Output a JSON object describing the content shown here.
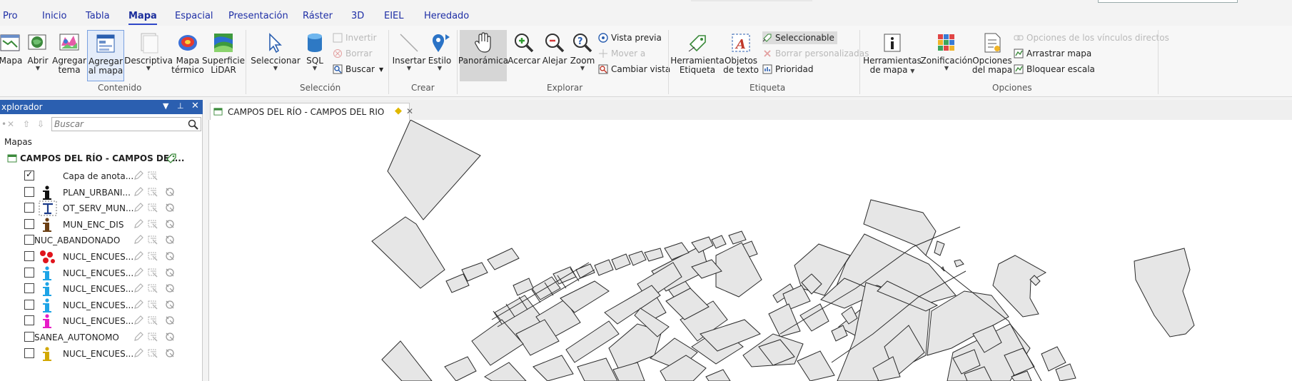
{
  "ribbon": {
    "tabs": [
      "Pro",
      "Inicio",
      "Tabla",
      "Mapa",
      "Espacial",
      "Presentación",
      "Ráster",
      "3D",
      "EIEL",
      "Heredado"
    ],
    "active_tab": "Mapa",
    "groups": {
      "contenido": {
        "label": "Contenido",
        "mapa": "Mapa",
        "abrir": "Abrir",
        "agregar_tema_1": "Agregar",
        "agregar_tema_2": "tema",
        "agregar_mapa_1": "Agregar",
        "agregar_mapa_2": "al mapa",
        "descriptiva": "Descriptiva",
        "termico_1": "Mapa",
        "termico_2": "térmico",
        "lidar_1": "Superficie",
        "lidar_2": "LiDAR"
      },
      "seleccion": {
        "label": "Selección",
        "seleccionar": "Seleccionar",
        "sql": "SQL",
        "invertir": "Invertir",
        "borrar": "Borrar",
        "buscar": "Buscar"
      },
      "crear": {
        "label": "Crear",
        "insertar": "Insertar",
        "estilo": "Estilo"
      },
      "explorar": {
        "label": "Explorar",
        "panoramica": "Panorámica",
        "acercar": "Acercar",
        "alejar": "Alejar",
        "zoom": "Zoom",
        "vista_previa": "Vista previa",
        "mover_a": "Mover a",
        "cambiar_vista": "Cambiar vista"
      },
      "etiqueta": {
        "label": "Etiqueta",
        "herramienta_1": "Herramienta",
        "herramienta_2": "Etiqueta",
        "objetos_1": "Objetos",
        "objetos_2": "de texto",
        "seleccionable": "Seleccionable",
        "borrar_personalizadas": "Borrar personalizadas",
        "prioridad": "Prioridad"
      },
      "opciones": {
        "label": "Opciones",
        "herramientas_1": "Herramientas",
        "herramientas_2": "de mapa",
        "zonificacion": "Zonificación",
        "opciones_1": "Opciones",
        "opciones_2": "del mapa",
        "vinculos": "Opciones de los vínculos directos",
        "arrastrar": "Arrastrar mapa",
        "bloquear": "Bloquear escala"
      }
    }
  },
  "explorer": {
    "title": "xplorador",
    "search_placeholder": "Buscar",
    "mapas_label": "Mapas",
    "map_name": "CAMPOS DEL RÍO - CAMPOS DEL...",
    "layers": [
      {
        "name": "Capa de anota...",
        "checked": true,
        "icon": "none"
      },
      {
        "name": "PLAN_URBANI...",
        "checked": false,
        "icon": "info-black"
      },
      {
        "name": "OT_SERV_MUN...",
        "checked": false,
        "icon": "pipe-icon"
      },
      {
        "name": "MUN_ENC_DIS",
        "checked": false,
        "icon": "info-brown"
      },
      {
        "name": "NUC_ABANDONADO",
        "checked": false,
        "icon": "none"
      },
      {
        "name": "NUCL_ENCUES...",
        "checked": false,
        "icon": "red-points"
      },
      {
        "name": "NUCL_ENCUES...",
        "checked": false,
        "icon": "info-cyan"
      },
      {
        "name": "NUCL_ENCUES...",
        "checked": false,
        "icon": "info-cyan"
      },
      {
        "name": "NUCL_ENCUES...",
        "checked": false,
        "icon": "info-cyan"
      },
      {
        "name": "NUCL_ENCUES...",
        "checked": false,
        "icon": "info-magenta"
      },
      {
        "name": "SANEA_AUTONOMO",
        "checked": false,
        "icon": "none"
      },
      {
        "name": "NUCL_ENCUES...",
        "checked": false,
        "icon": "info-yellow"
      }
    ]
  },
  "document": {
    "tab_title": "CAMPOS DEL RÍO - CAMPOS DEL RIO"
  },
  "colors": {
    "accent": "#2b5fb0",
    "tab_text": "#1f2fa6",
    "parcel_fill": "#e6e6e6",
    "parcel_stroke": "#2a2a2a"
  }
}
